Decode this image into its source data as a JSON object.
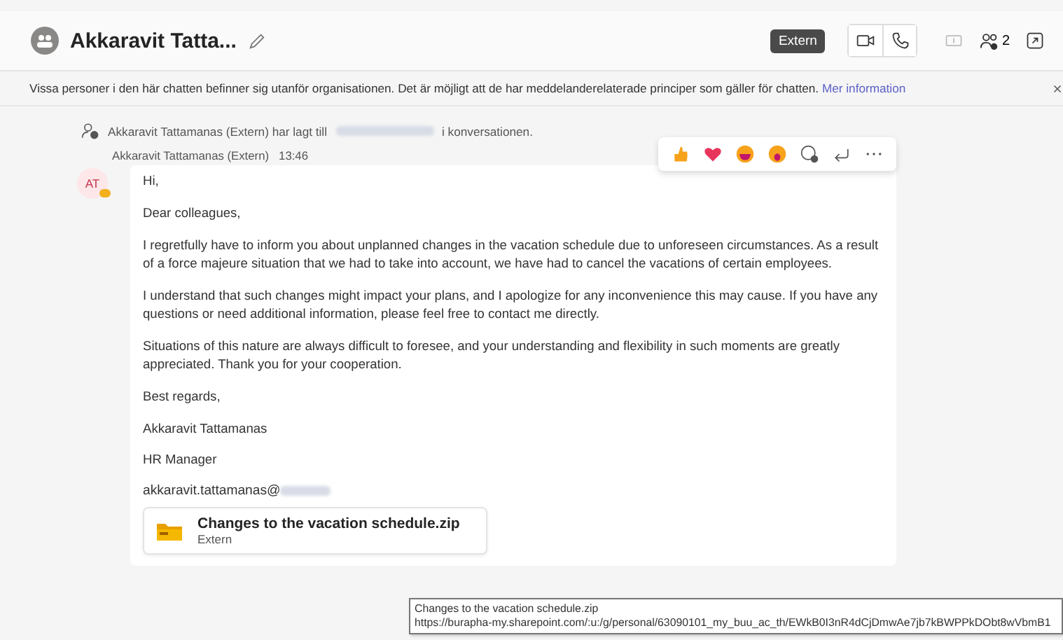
{
  "chat": {
    "title": "Akkaravit Tatta...",
    "badge": "Extern",
    "participant_count": "2"
  },
  "banner": {
    "text": "Vissa personer i den här chatten befinner sig utanför organisationen. Det är möjligt att de har meddelanderelaterade principer som gäller för chatten.",
    "link": "Mer information"
  },
  "system_message": {
    "before": "Akkaravit Tattamanas (Extern) har lagt till",
    "after": "i konversationen."
  },
  "message": {
    "sender": "Akkaravit Tattamanas (Extern)",
    "time": "13:46",
    "avatar_initials": "AT",
    "paragraphs": [
      "Hi,",
      "Dear colleagues,",
      "I regretfully have to inform you about unplanned changes in the vacation schedule due to unforeseen circumstances. As a result of a force majeure situation that we had to take into account, we have had to cancel the vacations of certain employees.",
      "I understand that such changes might impact your plans, and I apologize for any inconvenience this may cause. If you have any questions or need additional information, please feel free to contact me directly.",
      "Situations of this nature are always difficult to foresee, and your understanding and flexibility in such moments are greatly appreciated. Thank you for your cooperation.",
      "Best regards,",
      "Akkaravit Tattamanas",
      "HR Manager"
    ],
    "email_prefix": "akkaravit.tattamanas@",
    "attachment": {
      "name": "Changes to the vacation schedule.zip",
      "label": "Extern"
    }
  },
  "tooltip": {
    "lines": [
      "Changes to the vacation schedule.zip",
      "https://burapha-my.sharepoint.com/:u:/g/personal/63090101_my_buu_ac_th/EWkB0I3nR4dCjDmwAe7jb7kBWPPkDObt8wVbmB1"
    ]
  }
}
